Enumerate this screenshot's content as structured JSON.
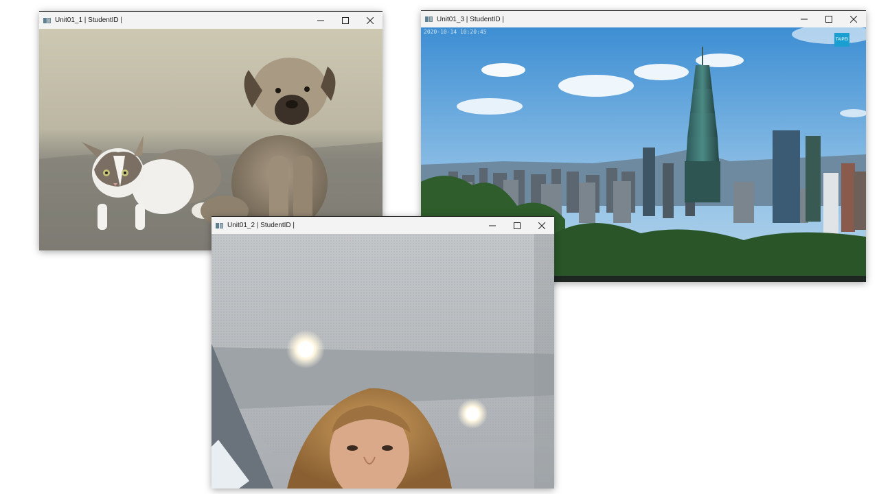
{
  "windows": [
    {
      "id": "unit01_1",
      "title": "Unit01_1 | StudentID |",
      "content": "cat-and-puppy-photo"
    },
    {
      "id": "unit01_3",
      "title": "Unit01_3 | StudentID |",
      "content": "city-skyline-photo",
      "timestamp": "2020-10-14 10:20:45",
      "logo_text": "TAIPEI"
    },
    {
      "id": "unit01_2",
      "title": "Unit01_2 | StudentID |",
      "content": "webcam-feed"
    }
  ],
  "icons": {
    "minimize": "minimize-icon",
    "maximize": "maximize-icon",
    "close": "close-icon",
    "app": "opencv-window-icon"
  }
}
